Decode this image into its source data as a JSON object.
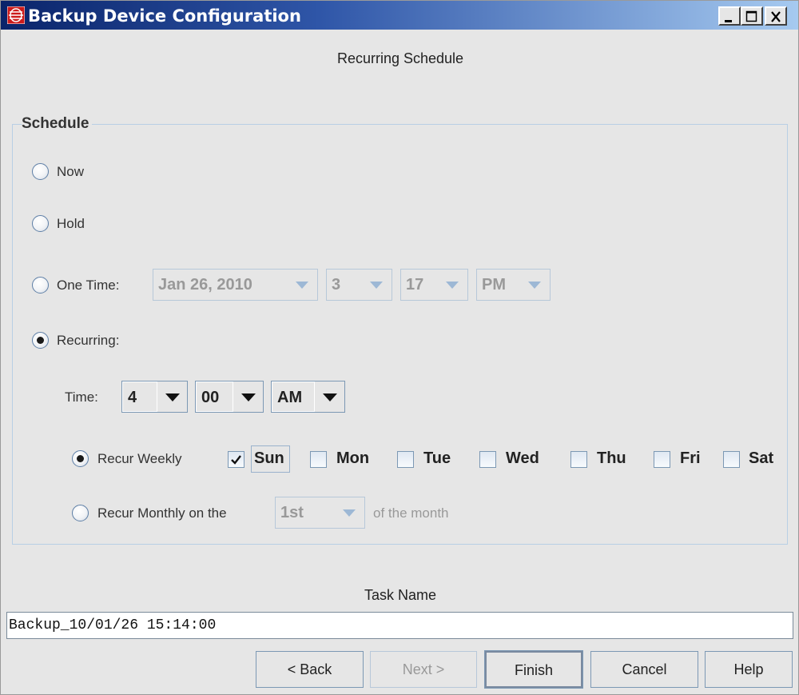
{
  "window": {
    "title": "Backup Device Configuration"
  },
  "page": {
    "subtitle": "Recurring Schedule"
  },
  "schedule": {
    "group_title": "Schedule",
    "options": {
      "now": {
        "label": "Now",
        "checked": false
      },
      "hold": {
        "label": "Hold",
        "checked": false
      },
      "one_time": {
        "label": "One Time:",
        "checked": false,
        "date": "Jan 26, 2010",
        "hour": "3",
        "minute": "17",
        "ampm": "PM"
      },
      "recurring": {
        "label": "Recurring:",
        "checked": true
      }
    },
    "time": {
      "label": "Time:",
      "hour": "4",
      "minute": "00",
      "ampm": "AM"
    },
    "weekly": {
      "label": "Recur Weekly",
      "checked": true,
      "days": [
        {
          "label": "Sun",
          "checked": true
        },
        {
          "label": "Mon",
          "checked": false
        },
        {
          "label": "Tue",
          "checked": false
        },
        {
          "label": "Wed",
          "checked": false
        },
        {
          "label": "Thu",
          "checked": false
        },
        {
          "label": "Fri",
          "checked": false
        },
        {
          "label": "Sat",
          "checked": false
        }
      ]
    },
    "monthly": {
      "label": "Recur Monthly on the",
      "checked": false,
      "day": "1st",
      "suffix": "of the month"
    }
  },
  "task": {
    "label": "Task Name",
    "value": "Backup_10/01/26 15:14:00"
  },
  "buttons": {
    "back": "< Back",
    "next": "Next >",
    "finish": "Finish",
    "cancel": "Cancel",
    "help": "Help"
  }
}
